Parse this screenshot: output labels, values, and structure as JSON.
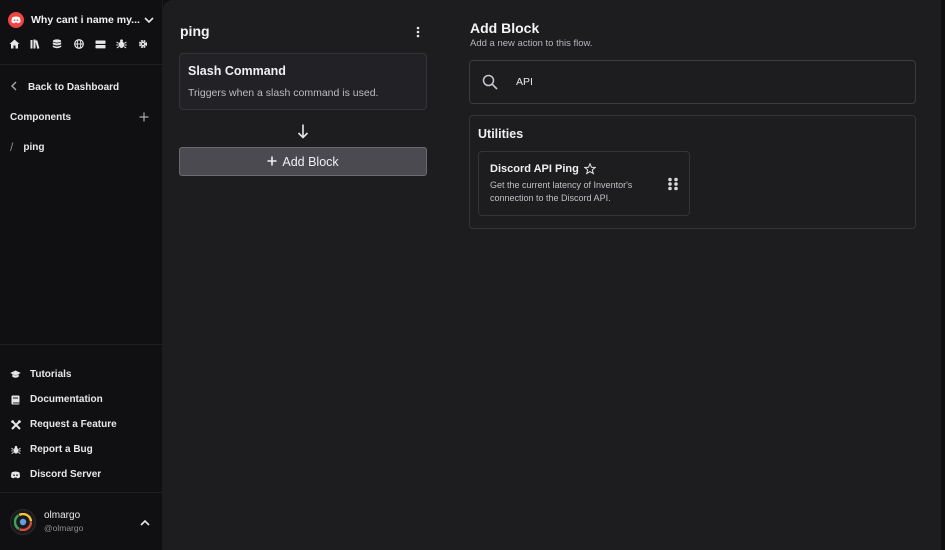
{
  "server": {
    "name": "Why cant i name my...",
    "logo_color": "#ef4444"
  },
  "toolbar_icons": [
    "home-icon",
    "library-icon",
    "database-icon",
    "globe-icon",
    "server-icon",
    "bug-icon",
    "gear-icon"
  ],
  "sidebar": {
    "back_label": "Back to Dashboard",
    "components_label": "Components",
    "components": [
      {
        "label": "ping"
      }
    ],
    "help_items": [
      {
        "label": "Tutorials",
        "icon": "graduation-cap-icon"
      },
      {
        "label": "Documentation",
        "icon": "book-icon"
      },
      {
        "label": "Request a Feature",
        "icon": "tools-icon"
      },
      {
        "label": "Report a Bug",
        "icon": "bug-icon"
      },
      {
        "label": "Discord Server",
        "icon": "discord-icon"
      }
    ],
    "user": {
      "name": "olmargo",
      "handle": "@olmargo"
    }
  },
  "flow": {
    "title": "ping",
    "trigger": {
      "title": "Slash Command",
      "description": "Triggers when a slash command is used."
    },
    "add_block_label": "Add Block"
  },
  "panel": {
    "title": "Add Block",
    "subtitle": "Add a new action to this flow.",
    "search_value": "API",
    "category": "Utilities",
    "blocks": [
      {
        "name": "Discord API Ping",
        "description": "Get the current latency of Inventor's connection to the Discord API."
      }
    ]
  },
  "colors": {
    "accent_red": "#ef4444",
    "bg_main": "#1d1d20",
    "bg_sidebar": "#101012"
  }
}
